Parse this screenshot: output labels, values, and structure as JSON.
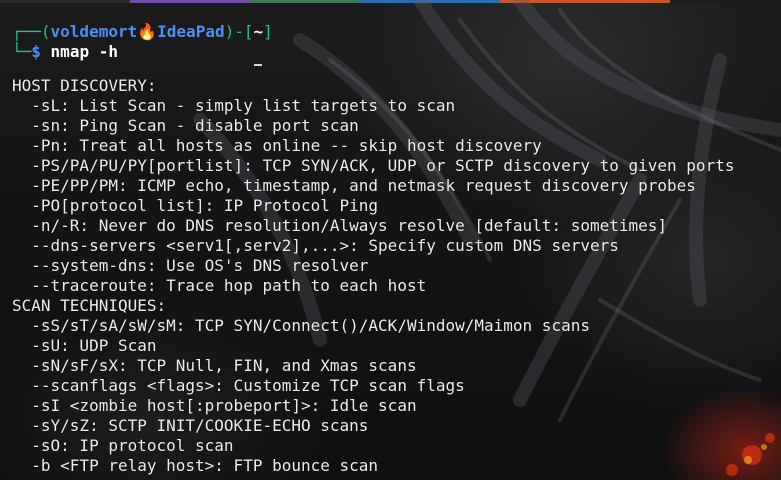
{
  "prompt": {
    "open": "┌──(",
    "user": "voldemort",
    "separator_icon": "fire-icon",
    "host": "IdeaPad",
    "mid": ")-[",
    "cwd": "~",
    "close": "]",
    "line2_prefix": "└─",
    "dollar": "$",
    "command": "nmap -h"
  },
  "colors": {
    "prompt_frame": "#26c281",
    "prompt_user": "#4d8ff5",
    "fire": "#ff6a1a",
    "text": "#ededed"
  },
  "output": [
    "HOST DISCOVERY:",
    "  -sL: List Scan - simply list targets to scan",
    "  -sn: Ping Scan - disable port scan",
    "  -Pn: Treat all hosts as online -- skip host discovery",
    "  -PS/PA/PU/PY[portlist]: TCP SYN/ACK, UDP or SCTP discovery to given ports",
    "  -PE/PP/PM: ICMP echo, timestamp, and netmask request discovery probes",
    "  -PO[protocol list]: IP Protocol Ping",
    "  -n/-R: Never do DNS resolution/Always resolve [default: sometimes]",
    "  --dns-servers <serv1[,serv2],...>: Specify custom DNS servers",
    "  --system-dns: Use OS's DNS resolver",
    "  --traceroute: Trace hop path to each host",
    "SCAN TECHNIQUES:",
    "  -sS/sT/sA/sW/sM: TCP SYN/Connect()/ACK/Window/Maimon scans",
    "  -sU: UDP Scan",
    "  -sN/sF/sX: TCP Null, FIN, and Xmas scans",
    "  --scanflags <flags>: Customize TCP scan flags",
    "  -sI <zombie host[:probeport]>: Idle scan",
    "  -sY/sZ: SCTP INIT/COOKIE-ECHO scans",
    "  -sO: IP protocol scan",
    "  -b <FTP relay host>: FTP bounce scan"
  ]
}
